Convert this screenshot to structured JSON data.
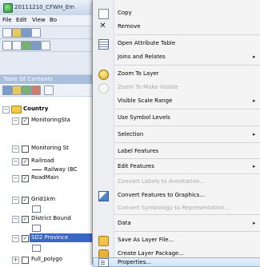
{
  "window": {
    "title": "20111210_CFWH_Em",
    "close_glyph": "✕",
    "menus": [
      "File",
      "Edit",
      "View",
      "Bo"
    ]
  },
  "toc": {
    "header": "Table Of Contents",
    "root": "Country",
    "layers": [
      {
        "name": "MonitoringSta",
        "checked": true
      },
      {
        "name": "Monitoring St",
        "checked": false
      },
      {
        "name": "Railroad",
        "checked": true
      },
      {
        "name": "Railway (BC",
        "legend": true
      },
      {
        "name": "RoadMain",
        "checked": true
      },
      {
        "name": "Grid1km",
        "checked": true
      },
      {
        "name": "District Bound",
        "checked": true
      },
      {
        "name": "SD2 Province",
        "checked": true,
        "selected": true
      },
      {
        "name": "Full_polygo",
        "checked": false
      }
    ]
  },
  "context_menu": {
    "items": [
      {
        "label": "Copy",
        "icon": "copy-icon"
      },
      {
        "label": "Remove",
        "icon": "remove-icon"
      },
      {
        "label": "Open Attribute Table",
        "icon": "table-icon"
      },
      {
        "label": "Joins and Relates",
        "submenu": true
      },
      {
        "label": "Zoom To Layer",
        "icon": "zoom-to-layer-icon"
      },
      {
        "label": "Zoom To Make Visible",
        "disabled": true,
        "icon": "zoom-visible-icon"
      },
      {
        "label": "Visible Scale Range",
        "submenu": true
      },
      {
        "label": "Use Symbol Levels"
      },
      {
        "label": "Selection",
        "submenu": true
      },
      {
        "label": "Label Features"
      },
      {
        "label": "Edit Features",
        "submenu": true
      },
      {
        "label": "Convert Labels to Annotation...",
        "disabled": true
      },
      {
        "label": "Convert Features to Graphics...",
        "icon": "convert-graphics-icon"
      },
      {
        "label": "Convert Symbology to Representation...",
        "disabled": true
      },
      {
        "label": "Data",
        "submenu": true
      },
      {
        "label": "Save As Layer File...",
        "icon": "save-layer-icon"
      },
      {
        "label": "Create Layer Package...",
        "icon": "layer-package-icon"
      },
      {
        "label": "Properties...",
        "icon": "properties-icon",
        "highlighted": true
      }
    ],
    "submenu_arrow": "▸"
  }
}
